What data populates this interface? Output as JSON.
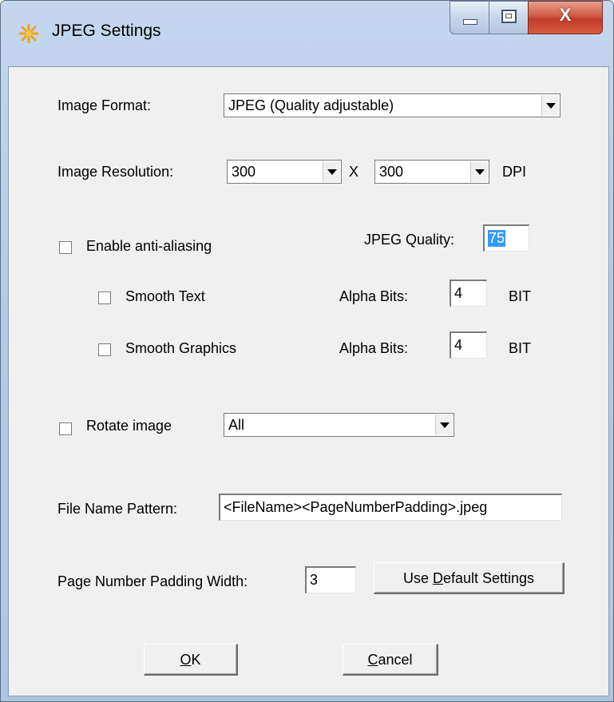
{
  "window": {
    "title": "JPEG Settings",
    "icon": "sun-asterisk-icon",
    "close_glyph": "X"
  },
  "image_format": {
    "label": "Image Format:",
    "value": "JPEG (Quality adjustable)"
  },
  "image_resolution": {
    "label": "Image Resolution:",
    "x_value": "300",
    "separator": "X",
    "y_value": "300",
    "unit": "DPI"
  },
  "anti_aliasing": {
    "label": "Enable anti-aliasing",
    "checked": false
  },
  "jpeg_quality": {
    "label": "JPEG Quality:",
    "value": "75"
  },
  "smooth_text": {
    "label": "Smooth Text",
    "checked": false,
    "alpha_label": "Alpha Bits:",
    "alpha_value": "4",
    "unit": "BIT"
  },
  "smooth_graphics": {
    "label": "Smooth Graphics",
    "checked": false,
    "alpha_label": "Alpha Bits:",
    "alpha_value": "4",
    "unit": "BIT"
  },
  "rotate": {
    "label": "Rotate image",
    "checked": false,
    "value": "All"
  },
  "file_name_pattern": {
    "label": "File Name Pattern:",
    "value": "<FileName><PageNumberPadding>.jpeg"
  },
  "padding": {
    "label": "Page Number Padding Width:",
    "value": "3"
  },
  "buttons": {
    "default_prefix": "Use ",
    "default_mnemonic": "D",
    "default_rest": "efault Settings",
    "ok_mnemonic": "O",
    "ok_rest": "K",
    "cancel_mnemonic": "C",
    "cancel_rest": "ancel"
  },
  "colors": {
    "frame": "#b6cbe6",
    "client_bg": "#f0f0f0",
    "selection": "#3399ff",
    "close_button": "#c23b28"
  }
}
